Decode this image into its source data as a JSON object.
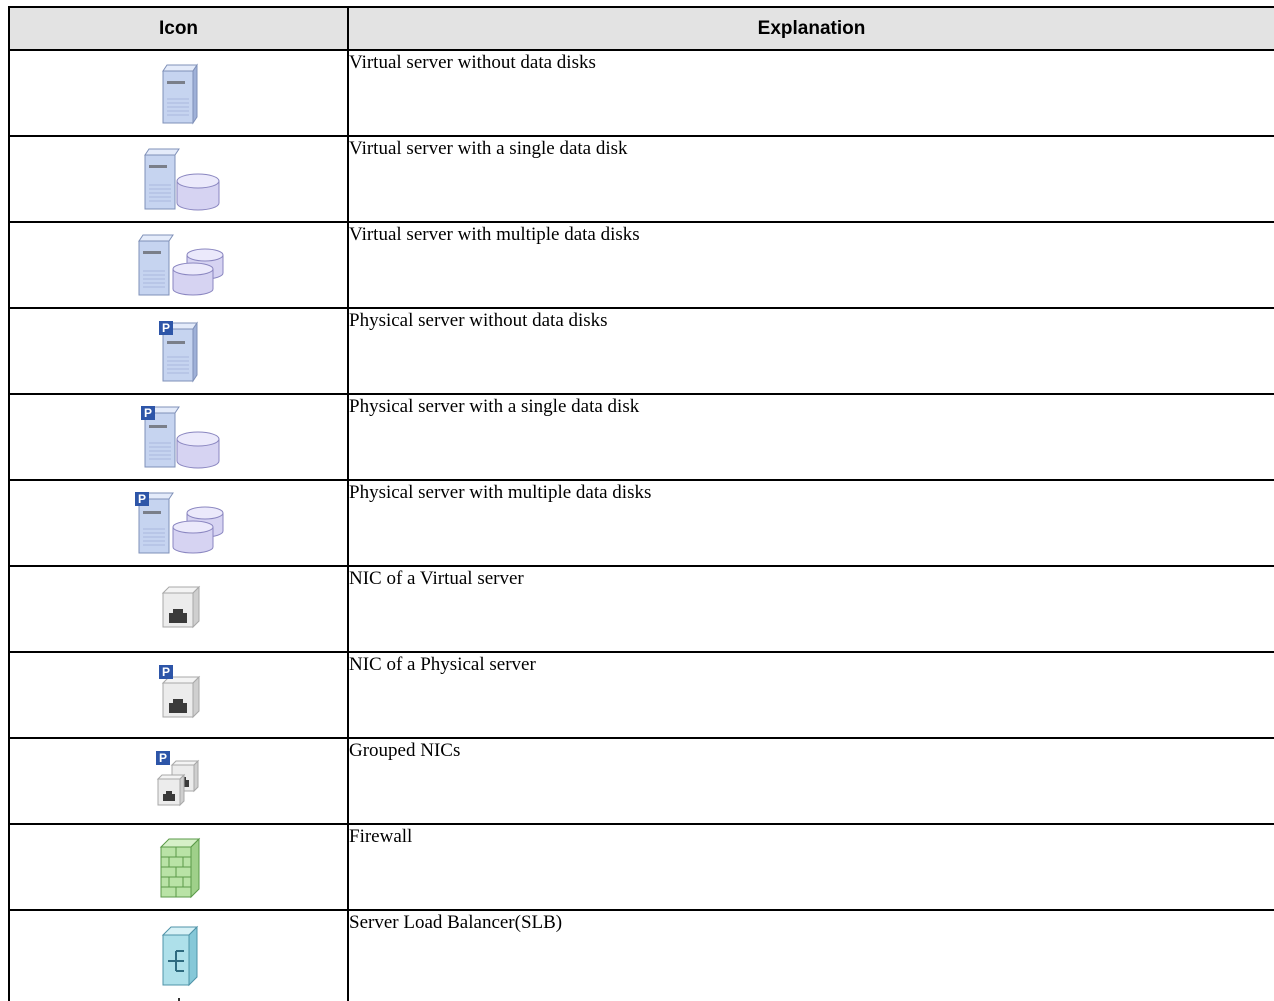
{
  "table": {
    "headers": {
      "icon": "Icon",
      "explanation": "Explanation"
    },
    "rows": [
      {
        "icon": "virtual-server-icon",
        "explanation": "Virtual server without data disks"
      },
      {
        "icon": "virtual-server-single-disk-icon",
        "explanation": "Virtual server with a single data disk"
      },
      {
        "icon": "virtual-server-multiple-disks-icon",
        "explanation": "Virtual server with multiple data disks"
      },
      {
        "icon": "physical-server-icon",
        "explanation": "Physical server without data disks"
      },
      {
        "icon": "physical-server-single-disk-icon",
        "explanation": "Physical server with a single data disk"
      },
      {
        "icon": "physical-server-multiple-disks-icon",
        "explanation": "Physical server with multiple data disks"
      },
      {
        "icon": "virtual-nic-icon",
        "explanation": "NIC of a Virtual server"
      },
      {
        "icon": "physical-nic-icon",
        "explanation": "NIC of a Physical server"
      },
      {
        "icon": "grouped-nics-icon",
        "explanation": "Grouped NICs"
      },
      {
        "icon": "firewall-icon",
        "explanation": "Firewall"
      },
      {
        "icon": "server-load-balancer-icon",
        "explanation": "Server Load Balancer(SLB)"
      }
    ]
  },
  "colors": {
    "header_bg": "#e3e3e3",
    "border": "#000000",
    "server_blue": "#c6d4f0",
    "disk_purple": "#d6d3f2",
    "badge_blue": "#2d55a8",
    "firewall_green": "#b9e3a6",
    "slb_cyan": "#aee0ea"
  }
}
